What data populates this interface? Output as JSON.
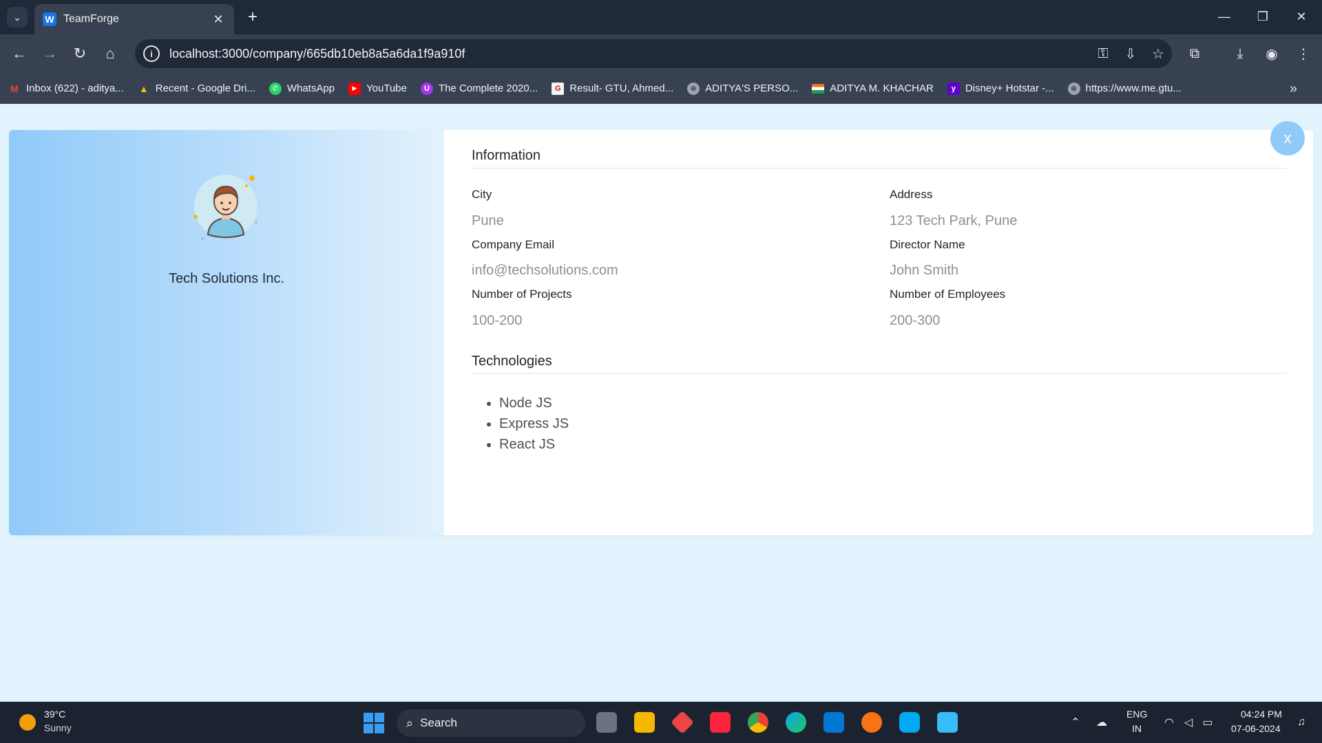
{
  "browser": {
    "tab_title": "TeamForge",
    "tab_favicon_letter": "W",
    "url": "localhost:3000/company/665db10eb8a5a6da1f9a910f",
    "bookmarks": [
      {
        "label": "Inbox (622) - aditya...",
        "color": "#ea4335",
        "glyph": "M"
      },
      {
        "label": "Recent - Google Dri...",
        "color": "#34a853",
        "glyph": "▲"
      },
      {
        "label": "WhatsApp",
        "color": "#25d366",
        "glyph": "✆"
      },
      {
        "label": "YouTube",
        "color": "#ff0000",
        "glyph": "▶"
      },
      {
        "label": "The Complete 2020...",
        "color": "#a435f0",
        "glyph": "U"
      },
      {
        "label": "Result- GTU, Ahmed...",
        "color": "#b91c1c",
        "glyph": "G"
      },
      {
        "label": "ADITYA'S PERSO...",
        "color": "#6b7280",
        "glyph": "⊕"
      },
      {
        "label": "ADITYA M. KHACHAR",
        "color": "#f97316",
        "glyph": "▬"
      },
      {
        "label": "Disney+ Hotstar -...",
        "color": "#6001d2",
        "glyph": "y"
      },
      {
        "label": "https://www.me.gtu...",
        "color": "#6b7280",
        "glyph": "⊕"
      }
    ]
  },
  "profile": {
    "company_name": "Tech Solutions Inc."
  },
  "information": {
    "section_title": "Information",
    "city_label": "City",
    "city_value": "Pune",
    "address_label": "Address",
    "address_value": "123 Tech Park, Pune",
    "email_label": "Company Email",
    "email_value": "info@techsolutions.com",
    "director_label": "Director Name",
    "director_value": "John Smith",
    "projects_label": "Number of Projects",
    "projects_value": "100-200",
    "employees_label": "Number of Employees",
    "employees_value": "200-300"
  },
  "technologies": {
    "section_title": "Technologies",
    "items": [
      "Node JS",
      "Express JS",
      "React JS"
    ]
  },
  "close_button_label": "x",
  "taskbar": {
    "temperature": "39°C",
    "weather": "Sunny",
    "search_label": "Search",
    "lang_primary": "ENG",
    "lang_secondary": "IN",
    "time": "04:24 PM",
    "date": "07-06-2024"
  }
}
